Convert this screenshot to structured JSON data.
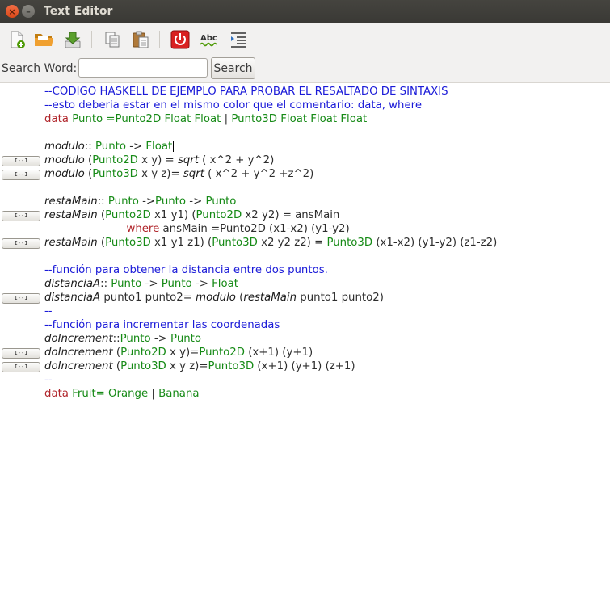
{
  "window": {
    "title": "Text Editor"
  },
  "toolbar": {
    "buttons": [
      {
        "name": "new-file",
        "icon": "new-document-icon"
      },
      {
        "name": "open-file",
        "icon": "folder-open-icon"
      },
      {
        "name": "save-file",
        "icon": "download-save-icon"
      },
      {
        "name": "copy",
        "icon": "copy-icon"
      },
      {
        "name": "paste",
        "icon": "paste-icon"
      },
      {
        "name": "quit",
        "icon": "power-icon"
      },
      {
        "name": "spell-check",
        "icon": "spellcheck-abc-icon",
        "text": "Abc"
      },
      {
        "name": "indent",
        "icon": "indent-icon"
      }
    ]
  },
  "search": {
    "label": "Search Word:",
    "value": "",
    "button_label": "Search"
  },
  "fold_marker": "I--I",
  "colors": {
    "comment": "#1a1ad8",
    "type": "#168a16",
    "keyword": "#b0242a"
  },
  "code_lines": [
    [
      [
        "c",
        "--CODIGO HASKELL DE EJEMPLO PARA PROBAR EL RESALTADO DE SINTAXIS"
      ]
    ],
    [
      [
        "c",
        "--esto deberia estar en el mismo color que el comentario: data, where"
      ]
    ],
    [
      [
        "k",
        "data"
      ],
      [
        "p",
        " "
      ],
      [
        "t",
        "Punto =Punto2D Float Float"
      ],
      [
        "p",
        " | "
      ],
      [
        "t",
        "Punto3D Float Float Float"
      ]
    ],
    [],
    [
      [
        "f",
        "modulo"
      ],
      [
        "p",
        ":: "
      ],
      [
        "t",
        "Punto"
      ],
      [
        "p",
        " -> "
      ],
      [
        "t",
        "Float"
      ]
    ],
    [
      [
        "f",
        "modulo"
      ],
      [
        "p",
        " ("
      ],
      [
        "t",
        "Punto2D"
      ],
      [
        "p",
        " x y) = "
      ],
      [
        "f",
        "sqrt"
      ],
      [
        "p",
        " ( x^2 + y^2)"
      ]
    ],
    [
      [
        "f",
        "modulo"
      ],
      [
        "p",
        " ("
      ],
      [
        "t",
        "Punto3D"
      ],
      [
        "p",
        " x y z)= "
      ],
      [
        "f",
        "sqrt"
      ],
      [
        "p",
        " ( x^2 + y^2 +z^2)"
      ]
    ],
    [],
    [
      [
        "f",
        "restaMain"
      ],
      [
        "p",
        "::"
      ],
      [
        "t",
        " Punto"
      ],
      [
        "p",
        " ->"
      ],
      [
        "t",
        "Punto"
      ],
      [
        "p",
        " -> "
      ],
      [
        "t",
        "Punto"
      ]
    ],
    [
      [
        "f",
        "restaMain"
      ],
      [
        "p",
        " ("
      ],
      [
        "t",
        "Punto2D"
      ],
      [
        "p",
        " x1 y1) ("
      ],
      [
        "t",
        "Punto2D"
      ],
      [
        "p",
        " x2 y2) = ansMain"
      ]
    ],
    [
      [
        "p",
        "                        "
      ],
      [
        "k",
        "where"
      ],
      [
        "p",
        " ansMain =Punto2D (x1-x2) (y1-y2)"
      ]
    ],
    [
      [
        "f",
        "restaMain"
      ],
      [
        "p",
        " ("
      ],
      [
        "t",
        "Punto3D"
      ],
      [
        "p",
        " x1 y1 z1) ("
      ],
      [
        "t",
        "Punto3D"
      ],
      [
        "p",
        " x2 y2 z2) = "
      ],
      [
        "t",
        "Punto3D"
      ],
      [
        "p",
        " (x1-x2) (y1-y2) (z1-z2)"
      ]
    ],
    [],
    [
      [
        "c",
        "--función para obtener la distancia entre dos puntos."
      ]
    ],
    [
      [
        "f",
        "distanciaA"
      ],
      [
        "p",
        ":: "
      ],
      [
        "t",
        "Punto"
      ],
      [
        "p",
        " -> "
      ],
      [
        "t",
        "Punto"
      ],
      [
        "p",
        " -> "
      ],
      [
        "t",
        "Float"
      ]
    ],
    [
      [
        "f",
        "distanciaA"
      ],
      [
        "p",
        " punto1 punto2= "
      ],
      [
        "f",
        "modulo"
      ],
      [
        "p",
        " ("
      ],
      [
        "f",
        "restaMain"
      ],
      [
        "p",
        " punto1 punto2)"
      ]
    ],
    [
      [
        "c",
        "--"
      ]
    ],
    [
      [
        "c",
        "--función para incrementar las coordenadas"
      ]
    ],
    [
      [
        "f",
        "doIncrement"
      ],
      [
        "p",
        "::"
      ],
      [
        "t",
        "Punto"
      ],
      [
        "p",
        " -> "
      ],
      [
        "t",
        "Punto"
      ]
    ],
    [
      [
        "f",
        "doIncrement"
      ],
      [
        "p",
        " ("
      ],
      [
        "t",
        "Punto2D"
      ],
      [
        "p",
        " x y)="
      ],
      [
        "t",
        "Punto2D"
      ],
      [
        "p",
        " (x+1) (y+1)"
      ]
    ],
    [
      [
        "f",
        "doIncrement"
      ],
      [
        "p",
        " ("
      ],
      [
        "t",
        "Punto3D"
      ],
      [
        "p",
        " x y z)="
      ],
      [
        "t",
        "Punto3D"
      ],
      [
        "p",
        " (x+1) (y+1) (z+1)"
      ]
    ],
    [
      [
        "c",
        "--"
      ]
    ],
    [
      [
        "k",
        "data"
      ],
      [
        "p",
        " "
      ],
      [
        "t",
        "Fruit= Orange"
      ],
      [
        "p",
        " | "
      ],
      [
        "t",
        "Banana"
      ]
    ]
  ],
  "folded_line_indices": [
    5,
    6,
    9,
    11,
    15,
    19,
    20
  ]
}
